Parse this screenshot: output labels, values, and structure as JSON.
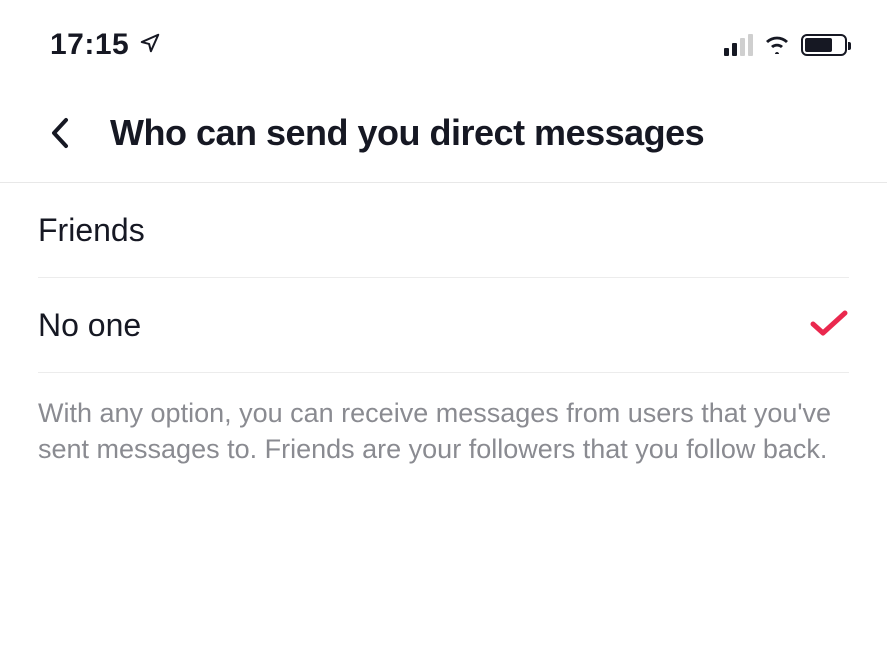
{
  "statusBar": {
    "time": "17:15"
  },
  "header": {
    "title": "Who can send you direct messages"
  },
  "options": [
    {
      "label": "Friends",
      "selected": false
    },
    {
      "label": "No one",
      "selected": true
    }
  ],
  "description": "With any option, you can receive messages from users that you've sent messages to. Friends are your followers that you follow back.",
  "colors": {
    "accent": "#ea284e"
  }
}
